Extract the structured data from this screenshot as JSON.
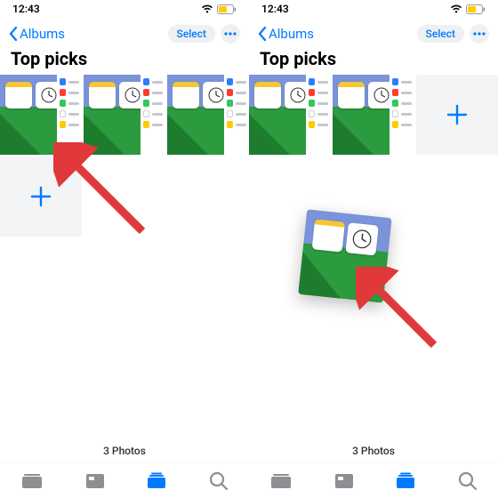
{
  "status": {
    "time": "12:43"
  },
  "nav": {
    "back": "Albums",
    "select": "Select"
  },
  "title": "Top picks",
  "footer_count": "3 Photos",
  "tabs": [
    "library",
    "for-you",
    "albums",
    "search"
  ],
  "colors": {
    "accent": "#007aff",
    "arrow": "#e0383b"
  },
  "thumbs": {
    "list_icons": [
      "#2a7fff",
      "#ff3b30",
      "#34c759",
      "#ffcc00"
    ]
  }
}
